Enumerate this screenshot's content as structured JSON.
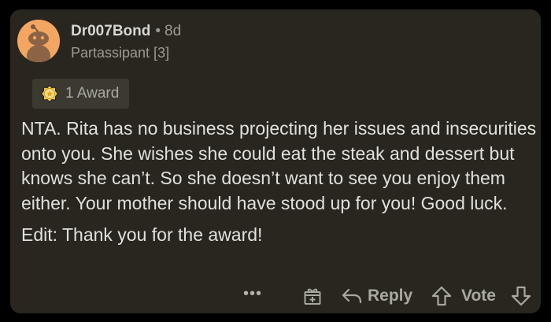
{
  "comment": {
    "author": "Dr007Bond",
    "separator": "•",
    "age": "8d",
    "flair": "Partassipant [3]",
    "award": {
      "icon": "award-medal-icon",
      "label": "1 Award"
    },
    "body": {
      "main": "NTA.  Rita has no business projecting her issues and insecurities onto you.  She wishes she could eat the steak and dessert but knows she can’t.  So she doesn’t want to see you enjoy them either.  Your mother should have stood up for you! Good luck.",
      "edit": "Edit: Thank you for the award!"
    }
  },
  "actions": {
    "more_label": "•••",
    "gift_icon": "gift-icon",
    "reply_icon": "reply-arrow-icon",
    "reply_label": "Reply",
    "upvote_icon": "upvote-arrow-icon",
    "vote_label": "Vote",
    "downvote_icon": "downvote-arrow-icon"
  },
  "colors": {
    "background": "#000000",
    "card": "#28261e",
    "avatar_bg": "#f3a562",
    "text": "#e1e1dc",
    "muted": "#9c9b93",
    "award_pill": "#3b3930"
  }
}
